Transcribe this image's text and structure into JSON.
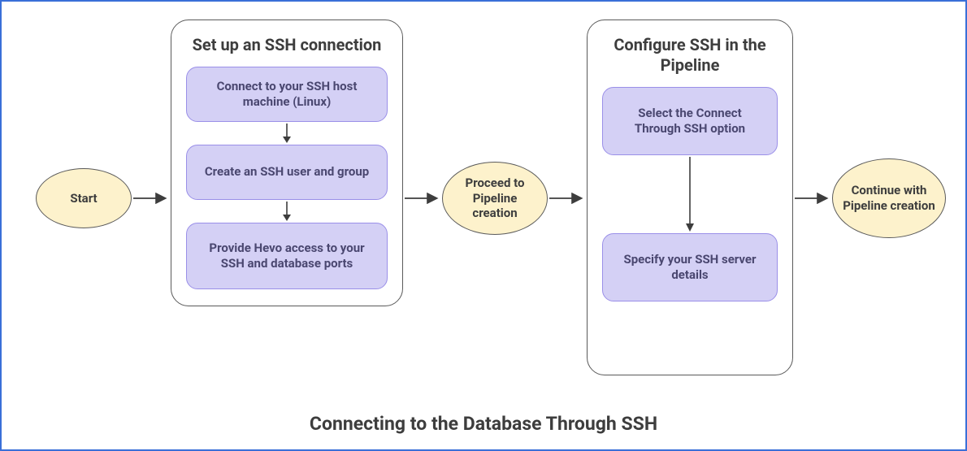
{
  "caption": "Connecting to the Database Through SSH",
  "nodes": {
    "start": "Start",
    "proceed": "Proceed to Pipeline creation",
    "continue": "Continue with Pipeline creation"
  },
  "container1": {
    "title": "Set up an SSH connection",
    "steps": [
      "Connect to your SSH host machine (Linux)",
      "Create an SSH user and group",
      "Provide Hevo access to your SSH and database ports"
    ]
  },
  "container2": {
    "title": "Configure SSH in the Pipeline",
    "steps": [
      "Select the Connect Through SSH option",
      "Specify your SSH server details"
    ]
  },
  "colors": {
    "ellipseFill": "#fdf2cc",
    "stepFill": "#d4d0f5",
    "border": "#5a5a5a",
    "frame": "#3a6fd8"
  }
}
